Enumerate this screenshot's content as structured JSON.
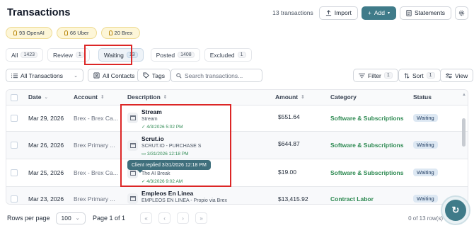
{
  "header": {
    "title": "Transactions",
    "count": "13 transactions",
    "import_label": "Import",
    "add_label": "Add",
    "statements_label": "Statements"
  },
  "chips": [
    {
      "label": "93 OpenAI"
    },
    {
      "label": "66 Uber"
    },
    {
      "label": "20 Brex"
    }
  ],
  "tabs": [
    {
      "label": "All",
      "count": "1423"
    },
    {
      "label": "Review",
      "count": "1"
    },
    {
      "label": "Waiting",
      "count": "13",
      "active": true
    },
    {
      "label": "Posted",
      "count": "1408"
    },
    {
      "label": "Excluded",
      "count": "1"
    }
  ],
  "toolbar": {
    "all_transactions": "All Transactions",
    "all_contacts": "All Contacts",
    "tags": "Tags",
    "search_placeholder": "Search transactions...",
    "filter": "Filter",
    "filter_count": "1",
    "sort": "Sort",
    "sort_count": "1",
    "view": "View"
  },
  "table": {
    "columns": [
      "Date",
      "Account",
      "Description",
      "Amount",
      "Category",
      "Status"
    ],
    "rows": [
      {
        "date": "Mar 29, 2026",
        "account": "Brex - Brex Ca...",
        "name": "Stream",
        "sub": "Stream",
        "meta": "4/3/2026 5:02 PM",
        "amount": "$551.64",
        "category": "Software & Subscriptions",
        "status": "Waiting"
      },
      {
        "date": "Mar 26, 2026",
        "account": "Brex Primary ...",
        "name": "Scrut.io",
        "sub": "SCRUT.IO - PURCHASE S",
        "meta": "3/31/2026 12:18 PM",
        "amount": "$644.87",
        "category": "Software & Subscriptions",
        "status": "Waiting"
      },
      {
        "date": "Mar 25, 2026",
        "account": "Brex - Brex Ca...",
        "name": "",
        "sub": "The AI Break",
        "meta": "4/3/2026 9:02 AM",
        "amount": "$19.00",
        "category": "Software & Subscriptions",
        "status": "Waiting"
      },
      {
        "date": "Mar 23, 2026",
        "account": "Brex Primary ...",
        "name": "Empleos En Linea",
        "sub": "EMPLEOS EN LINEA - Propio via Brex",
        "meta": "",
        "amount": "$13,415.92",
        "category": "Contract Labor",
        "status": "Waiting"
      }
    ],
    "tooltip": "Client replied 3/31/2026 12:18 PM"
  },
  "footer": {
    "rows_per_page_label": "Rows per page",
    "rows_per_page": "100",
    "page_info": "Page 1 of 1",
    "row_count": "0 of 13 row(s)"
  },
  "colors": {
    "brand": "#3f7b89",
    "category": "#2e8a52",
    "status_bg": "#dde8f3",
    "highlight": "#dc2626"
  },
  "icons": [
    "upload-icon",
    "plus-icon",
    "document-icon",
    "gear-icon",
    "bulb-icon",
    "list-icon",
    "contacts-icon",
    "tag-icon",
    "search-icon",
    "filter-icon",
    "sort-icon",
    "view-icon",
    "check-icon",
    "comment-icon",
    "bank-icon"
  ]
}
